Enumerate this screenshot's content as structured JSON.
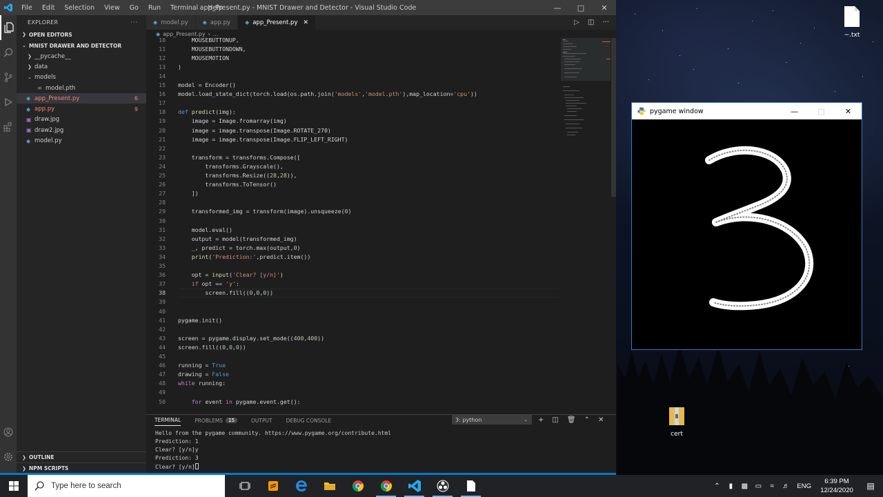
{
  "vscode": {
    "window_title": "app_Present.py - MNIST Drawer and Detector - Visual Studio Code",
    "menu": [
      "File",
      "Edit",
      "Selection",
      "View",
      "Go",
      "Run",
      "Terminal",
      "Help"
    ],
    "explorer": {
      "header": "EXPLORER",
      "open_editors": "OPEN EDITORS",
      "project": "MNIST DRAWER AND DETECTOR",
      "tree": [
        {
          "label": "__pycache__",
          "type": "folder",
          "depth": 1,
          "expanded": false
        },
        {
          "label": "data",
          "type": "folder",
          "depth": 1,
          "expanded": false
        },
        {
          "label": "models",
          "type": "folder",
          "depth": 1,
          "expanded": true
        },
        {
          "label": "model.pth",
          "type": "file",
          "depth": 2
        },
        {
          "label": "app_Present.py",
          "type": "py",
          "depth": 1,
          "badge": "6",
          "selected": true,
          "error": true
        },
        {
          "label": "app.py",
          "type": "py",
          "depth": 1,
          "badge": "9",
          "error": true
        },
        {
          "label": "draw.jpg",
          "type": "img",
          "depth": 1
        },
        {
          "label": "draw2.jpg",
          "type": "img",
          "depth": 1
        },
        {
          "label": "model.py",
          "type": "py",
          "depth": 1
        }
      ],
      "outline": "OUTLINE",
      "npm_scripts": "NPM SCRIPTS"
    },
    "tabs": [
      {
        "label": "model.py",
        "active": false
      },
      {
        "label": "app.py",
        "active": false
      },
      {
        "label": "app_Present.py",
        "active": true
      }
    ],
    "breadcrumb": [
      "app_Present.py",
      "..."
    ],
    "current_line": "38",
    "code_lines": [
      {
        "n": "10",
        "html": "    MOUSEBUTTONUP,"
      },
      {
        "n": "11",
        "html": "    MOUSEBUTTONDOWN,"
      },
      {
        "n": "12",
        "html": "    MOUSEMOTION"
      },
      {
        "n": "13",
        "html": ")"
      },
      {
        "n": "14",
        "html": ""
      },
      {
        "n": "15",
        "html": "model = Encoder()"
      },
      {
        "n": "16",
        "html": "model.load_state_dict(torch.load(os.path.join(<span class=\"str\">'models'</span>,<span class=\"str\">'model.pth'</span>),map_location=<span class=\"str\">'cpu'</span>))"
      },
      {
        "n": "17",
        "html": ""
      },
      {
        "n": "18",
        "html": "<span class=\"kw\">def</span> <span class=\"fn\">predict</span>(img):"
      },
      {
        "n": "19",
        "html": "    image = Image.fromarray(img)"
      },
      {
        "n": "20",
        "html": "    image = image.transpose(Image.ROTATE_270)"
      },
      {
        "n": "21",
        "html": "    image = image.transpose(Image.FLIP_LEFT_RIGHT)"
      },
      {
        "n": "22",
        "html": ""
      },
      {
        "n": "23",
        "html": "    transform = transforms.Compose(["
      },
      {
        "n": "24",
        "html": "        transforms.Grayscale(),"
      },
      {
        "n": "25",
        "html": "        transforms.Resize((<span class=\"num\">28</span>,<span class=\"num\">28</span>)),"
      },
      {
        "n": "26",
        "html": "        transforms.ToTensor()"
      },
      {
        "n": "27",
        "html": "    ])"
      },
      {
        "n": "28",
        "html": ""
      },
      {
        "n": "29",
        "html": "    transformed_img = transform(image).unsqueeze(<span class=\"num\">0</span>)"
      },
      {
        "n": "30",
        "html": ""
      },
      {
        "n": "31",
        "html": "    model.eval()"
      },
      {
        "n": "32",
        "html": "    output = model(transformed_img)"
      },
      {
        "n": "33",
        "html": "    _, predict = torch.max(output,<span class=\"num\">0</span>)"
      },
      {
        "n": "34",
        "html": "    <span class=\"fn\">print</span>(<span class=\"str\">'Prediction:'</span>,predict.item())"
      },
      {
        "n": "35",
        "html": ""
      },
      {
        "n": "36",
        "html": "    opt = <span class=\"fn\">input</span>(<span class=\"str\">'Clear? [y/n]'</span>)"
      },
      {
        "n": "37",
        "html": "    <span class=\"ct\">if</span> opt == <span class=\"str\">'y'</span>:"
      },
      {
        "n": "38",
        "html": "        screen.fill((<span class=\"num\">0</span>,<span class=\"num\">0</span>,<span class=\"num\">0</span>))"
      },
      {
        "n": "39",
        "html": ""
      },
      {
        "n": "40",
        "html": ""
      },
      {
        "n": "41",
        "html": "pygame.init()"
      },
      {
        "n": "42",
        "html": ""
      },
      {
        "n": "43",
        "html": "screen = pygame.display.set_mode((<span class=\"num\">400</span>,<span class=\"num\">400</span>))"
      },
      {
        "n": "44",
        "html": "screen.fill((<span class=\"num\">0</span>,<span class=\"num\">0</span>,<span class=\"num\">0</span>))"
      },
      {
        "n": "45",
        "html": ""
      },
      {
        "n": "46",
        "html": "running = <span class=\"kw\">True</span>"
      },
      {
        "n": "47",
        "html": "drawing = <span class=\"kw\">False</span>"
      },
      {
        "n": "48",
        "html": "<span class=\"ct\">while</span> running:"
      },
      {
        "n": "49",
        "html": ""
      },
      {
        "n": "50",
        "html": "    <span class=\"ct\">for</span> event <span class=\"ct\">in</span> pygame.event.get():"
      }
    ],
    "panel": {
      "tabs": [
        {
          "label": "TERMINAL",
          "active": true
        },
        {
          "label": "PROBLEMS",
          "count": "15"
        },
        {
          "label": "OUTPUT"
        },
        {
          "label": "DEBUG CONSOLE"
        }
      ],
      "terminal_select": "3: python",
      "terminal_lines": [
        "Hello from the pygame community. https://www.pygame.org/contribute.html",
        "Prediction: 1",
        "Clear? [y/n]y",
        "Prediction: 3",
        "Clear? [y/n]"
      ]
    }
  },
  "pygame": {
    "title": "pygame window",
    "drawn_digit": "3"
  },
  "desktop_icons": [
    {
      "label": "~.txt"
    },
    {
      "label": "cert"
    }
  ],
  "taskbar": {
    "search_placeholder": "Type here to search",
    "language": "ENG",
    "time": "6:39 PM",
    "date": "12/24/2020"
  },
  "colors": {
    "accent": "#007acc",
    "editor_bg": "#1e1e1e",
    "sidebar_bg": "#252526",
    "error": "#f48771"
  }
}
